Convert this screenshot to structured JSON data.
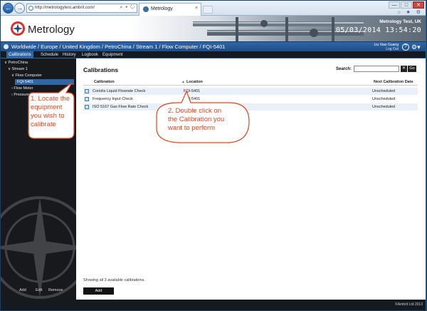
{
  "browser": {
    "url": "http://metrologytest.ambrit.com/",
    "address_icons": "⌕ ▾ ↻",
    "tab_title": "Metrology",
    "tab_close": "×",
    "window_buttons": [
      "—",
      "□",
      "✕"
    ],
    "toolbar_icons": "⌂ ★ ⚙"
  },
  "header": {
    "logo_text": "Metrology",
    "instance": "Metrology Test, UK",
    "datetime": "05/03/2014  13:54:20"
  },
  "breadcrumb": {
    "path": "Worldwide / Europe / United Kingdom / PetroChina / Stream 1 / Flow Computer / FQI-5401",
    "user": "Liu Xiao Guang",
    "logout": "Log Out",
    "help": "?",
    "gear": "⚙▾"
  },
  "tabs": [
    {
      "label": "Calibrations",
      "active": true
    },
    {
      "label": "Schedule",
      "active": false
    },
    {
      "label": "History",
      "active": false
    },
    {
      "label": "Logbook",
      "active": false
    },
    {
      "label": "Equipment",
      "active": false
    }
  ],
  "tree": [
    {
      "label": "∨ PetroChina"
    },
    {
      "label": "∨ Stream 1"
    },
    {
      "label": "∨ Flow Computer"
    },
    {
      "label": "FQI-5401",
      "selected": true
    },
    {
      "label": "› Flow Meter"
    },
    {
      "label": "› Pressure"
    }
  ],
  "sidebar_actions": [
    "Add",
    "Edit",
    "Remove"
  ],
  "main": {
    "title": "Calibrations",
    "search_label": "Search:",
    "clear": "✕",
    "go": "Go",
    "columns": [
      "Calibration",
      "Location",
      "Next Calibration Date"
    ],
    "sort_icon": "▲",
    "rows": [
      {
        "calibration": "Coriolis Liquid Flowrate Check",
        "location": "FQI-5401",
        "next": "Unscheduled"
      },
      {
        "calibration": "Frequency Input Check",
        "location": "FQI-5401",
        "next": "Unscheduled"
      },
      {
        "calibration": "ISO 5167 Gas Flow Rate Check",
        "location": "FQI-5401",
        "next": "Unscheduled"
      }
    ],
    "footer": "Showing all 3 available calibrations.",
    "add": "Add"
  },
  "footer": {
    "copyright": "©Ambrit Ltd 2013"
  },
  "annotations": {
    "step1": [
      "1. Locate the",
      "equipment",
      "you wish to",
      "calibrate"
    ],
    "step2": [
      "2. Double click on",
      "the Calibration you",
      "want to perform"
    ],
    "color": "#e8431b"
  }
}
